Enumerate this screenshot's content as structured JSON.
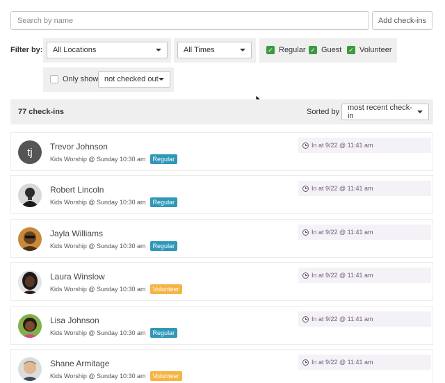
{
  "search": {
    "placeholder": "Search by name",
    "add_label": "Add check-ins"
  },
  "filters": {
    "label": "Filter by:",
    "location": "All Locations",
    "time": "All Times",
    "types": [
      {
        "label": "Regular",
        "checked": true
      },
      {
        "label": "Guest",
        "checked": true
      },
      {
        "label": "Volunteer",
        "checked": true
      }
    ],
    "only_show_label": "Only show",
    "only_show_value": "not checked out"
  },
  "summary": {
    "count_label": "77 check-ins",
    "sorted_label": "Sorted by",
    "sort_value": "most recent check-in"
  },
  "colors": {
    "regular": "#2f97b7",
    "volunteer": "#f5b445",
    "check": "#3b9a3f"
  },
  "checkins": [
    {
      "initials": "tj",
      "name": "Trevor Johnson",
      "event": "Kids Worship @ Sunday 10:30 am",
      "type": "Regular",
      "time": "In at 9/22 @ 11:41 am",
      "avatar_icon": "initials-avatar"
    },
    {
      "initials": "",
      "name": "Robert Lincoln",
      "event": "Kids Worship @ Sunday 10:30 am",
      "type": "Regular",
      "time": "In at 9/22 @ 11:41 am",
      "avatar_icon": "person-photo-avatar"
    },
    {
      "initials": "",
      "name": "Jayla Williams",
      "event": "Kids Worship @ Sunday 10:30 am",
      "type": "Regular",
      "time": "In at 9/22 @ 11:41 am",
      "avatar_icon": "person-photo-avatar"
    },
    {
      "initials": "",
      "name": "Laura Winslow",
      "event": "Kids Worship @ Sunday 10:30 am",
      "type": "Volunteer",
      "time": "In at 9/22 @ 11:41 am",
      "avatar_icon": "person-photo-avatar"
    },
    {
      "initials": "",
      "name": "Lisa Johnson",
      "event": "Kids Worship @ Sunday 10:30 am",
      "type": "Regular",
      "time": "In at 9/22 @ 11:41 am",
      "avatar_icon": "person-photo-avatar"
    },
    {
      "initials": "",
      "name": "Shane Armitage",
      "event": "Kids Worship @ Sunday 10:30 am",
      "type": "Volunteer",
      "time": "In at 9/22 @ 11:41 am",
      "avatar_icon": "person-photo-avatar"
    }
  ]
}
